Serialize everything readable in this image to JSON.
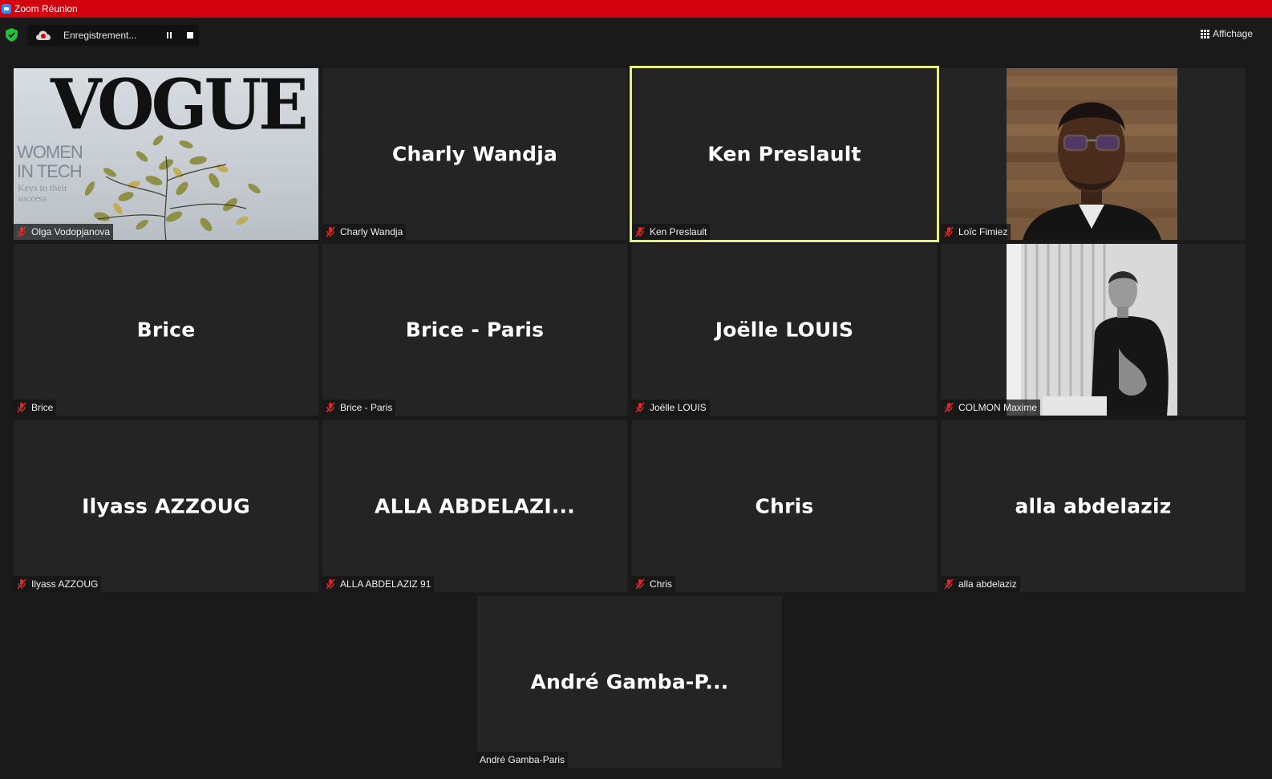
{
  "window": {
    "title": "Zoom Réunion"
  },
  "toolbar": {
    "recording_label": "Enregistrement...",
    "view_label": "Affichage"
  },
  "colors": {
    "titlebar": "#d2030f",
    "active_speaker_border": "#e6f07a",
    "tile_background": "#242424",
    "mic_muted": "#e02828"
  },
  "participants": [
    {
      "display": "",
      "label": "Olga Vodopjanova",
      "muted": true,
      "video": "vogue-cover",
      "video_text": {
        "headline": "VOGUE",
        "line1": "WOMEN",
        "line2": "IN TECH",
        "tagline": "Keys to their success"
      }
    },
    {
      "display": "Charly Wandja",
      "label": "Charly Wandja",
      "muted": true
    },
    {
      "display": "Ken Preslault",
      "label": "Ken Preslault",
      "muted": true,
      "active_speaker": true
    },
    {
      "display": "",
      "label": "Loïc Fimiez",
      "muted": true,
      "video": "webcam-portrait"
    },
    {
      "display": "Brice",
      "label": "Brice",
      "muted": true
    },
    {
      "display": "Brice - Paris",
      "label": "Brice - Paris",
      "muted": true
    },
    {
      "display": "Joëlle LOUIS",
      "label": "Joëlle LOUIS",
      "muted": true
    },
    {
      "display": "",
      "label": "COLMON Maxime",
      "muted": true,
      "video": "webcam-bw"
    },
    {
      "display": "Ilyass AZZOUG",
      "label": "Ilyass AZZOUG",
      "muted": true
    },
    {
      "display": "ALLA  ABDELAZI...",
      "label": "ALLA ABDELAZIZ 91",
      "muted": true
    },
    {
      "display": "Chris",
      "label": "Chris",
      "muted": true
    },
    {
      "display": "alla abdelaziz",
      "label": "alla abdelaziz",
      "muted": true
    },
    {
      "display": "André  Gamba-P...",
      "label": "André Gamba-Paris",
      "muted": false
    }
  ]
}
